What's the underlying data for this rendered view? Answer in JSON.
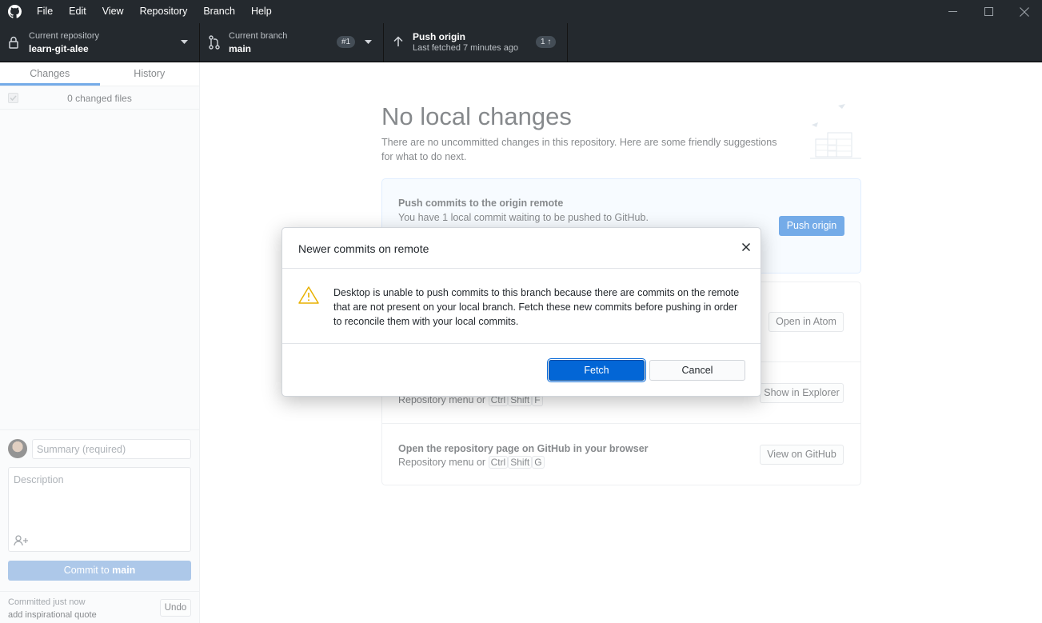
{
  "menu": [
    "File",
    "Edit",
    "View",
    "Repository",
    "Branch",
    "Help"
  ],
  "toolbar": {
    "repo_label": "Current repository",
    "repo_name": "learn-git-alee",
    "branch_label": "Current branch",
    "branch_name": "main",
    "branch_badge": "#1",
    "push_label": "Push origin",
    "push_sub": "Last fetched 7 minutes ago",
    "push_badge": "1 ↑"
  },
  "sidebar": {
    "tab_changes": "Changes",
    "tab_history": "History",
    "changed_files": "0 changed files",
    "summary_placeholder": "Summary (required)",
    "description_placeholder": "Description",
    "commit_button_prefix": "Commit to ",
    "commit_button_branch": "main",
    "last_commit_time": "Committed just now",
    "last_commit_message": "add inspirational quote",
    "undo_label": "Undo"
  },
  "main": {
    "title": "No local changes",
    "subtitle": "There are no uncommitted changes in this repository. Here are some friendly suggestions for what to do next.",
    "push_card": {
      "title": "Push commits to the origin remote",
      "desc": "You have 1 local commit waiting to be pushed to GitHub.",
      "button": "Push origin"
    },
    "atom_card": {
      "button": "Open in Atom"
    },
    "explorer_card": {
      "shortcut_prefix": "Repository menu or",
      "keys": [
        "Ctrl",
        "Shift",
        "F"
      ],
      "button": "Show in Explorer"
    },
    "github_card": {
      "title": "Open the repository page on GitHub in your browser",
      "shortcut_prefix": "Repository menu or",
      "keys": [
        "Ctrl",
        "Shift",
        "G"
      ],
      "button": "View on GitHub"
    }
  },
  "dialog": {
    "title": "Newer commits on remote",
    "body": "Desktop is unable to push commits to this branch because there are commits on the remote that are not present on your local branch. Fetch these new commits before pushing in order to reconcile them with your local commits.",
    "fetch_label": "Fetch",
    "cancel_label": "Cancel"
  },
  "colors": {
    "accent": "#0366d6",
    "toolbar_bg": "#24292e",
    "warning": "#e8b100"
  }
}
